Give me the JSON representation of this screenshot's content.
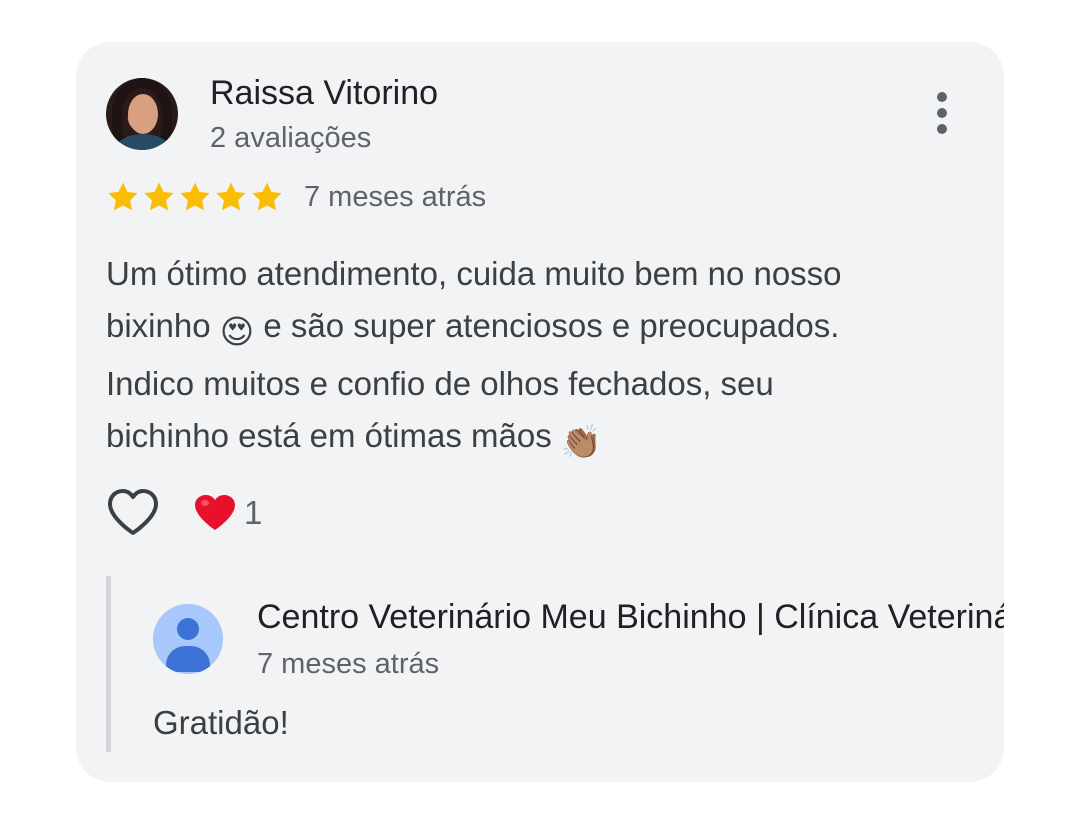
{
  "review": {
    "author": {
      "name": "Raissa Vitorino",
      "meta": "2 avaliações",
      "avatar_icon": "profile-photo"
    },
    "rating": 5,
    "rating_max": 5,
    "date": "7 meses atrás",
    "text_line1": "Um ótimo atendimento, cuida muito bem no nosso",
    "text_line2a": "bixinho ",
    "text_line2b": " e são super atenciosos e preocupados.",
    "text_line3": "Indico muitos e confio de olhos fechados, seu",
    "text_line4": "bichinho está em ótimas mãos ",
    "emoji_1": "😍",
    "emoji_2": "👏🏽",
    "reactions": {
      "like_icon": "heart-outline-icon",
      "summary_icon": "red-heart-icon",
      "count": "1"
    },
    "menu_icon": "more-vertical-icon"
  },
  "reply": {
    "owner_name": "Centro Veterinário Meu Bichinho | Clínica Veterinária",
    "owner_icon": "default-user-icon",
    "date": "7 meses atrás",
    "text": "Gratidão!"
  },
  "colors": {
    "card_bg": "#f2f3f5",
    "star": "#fbbc04",
    "heart": "#e8112d",
    "owner_avatar_bg": "#a8c7fa",
    "owner_avatar_fg": "#3d73d6"
  }
}
